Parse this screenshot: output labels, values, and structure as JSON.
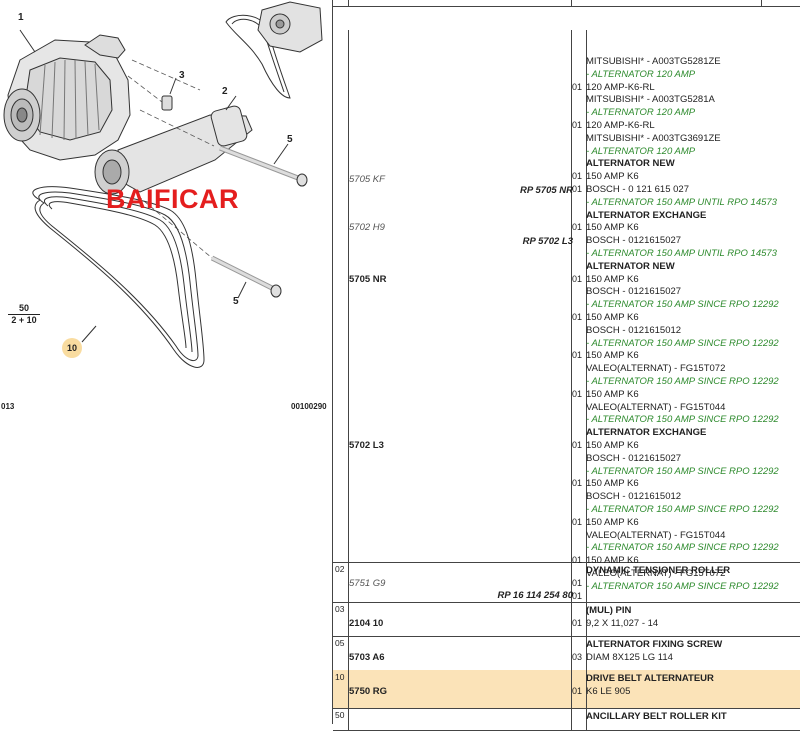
{
  "diagram": {
    "callouts": {
      "c1": "1",
      "c2": "2",
      "c3": "3",
      "c5a": "5",
      "c5b": "5"
    },
    "callout_10": "10",
    "fraction": {
      "num": "50",
      "den": "2 + 10"
    },
    "watermark": "BAIFICAR",
    "ref_left": "013",
    "ref_right": "00100290"
  },
  "table": {
    "header_fragment": "",
    "rows": [
      {
        "line": "",
        "refs": [
          {
            "text": "5705 KF",
            "style": "it",
            "top": 0
          },
          {
            "text": "5702 H9",
            "style": "it",
            "top": 0
          },
          {
            "text": "5705 NR",
            "style": "bold",
            "top": 0
          },
          {
            "text": "5702 L3",
            "style": "bold",
            "top": 0
          }
        ],
        "rps": [
          "RP 5705 NR",
          "RP 5702 L3"
        ],
        "entries": [
          {
            "q": "",
            "t": "MITSUBISHI* - A003TG5281ZE",
            "s": ""
          },
          {
            "q": "",
            "t": "- ALTERNATOR 120 AMP",
            "s": "g"
          },
          {
            "q": "01",
            "t": "120 AMP-K6-RL",
            "s": ""
          },
          {
            "q": "",
            "t": "MITSUBISHI* - A003TG5281A",
            "s": ""
          },
          {
            "q": "",
            "t": "- ALTERNATOR 120 AMP",
            "s": "g"
          },
          {
            "q": "01",
            "t": "120 AMP-K6-RL",
            "s": ""
          },
          {
            "q": "",
            "t": "MITSUBISHI* - A003TG3691ZE",
            "s": ""
          },
          {
            "q": "",
            "t": "- ALTERNATOR 120 AMP",
            "s": "g"
          },
          {
            "q": "",
            "t": "ALTERNATOR NEW",
            "s": "b"
          },
          {
            "q": "01",
            "t": "150 AMP K6",
            "s": ""
          },
          {
            "q": "01",
            "t": "BOSCH - 0 121 615 027",
            "s": ""
          },
          {
            "q": "",
            "t": "- ALTERNATOR 150 AMP UNTIL RPO 14573",
            "s": "g"
          },
          {
            "q": "",
            "t": "ALTERNATOR EXCHANGE",
            "s": "b"
          },
          {
            "q": "01",
            "t": "150 AMP K6",
            "s": ""
          },
          {
            "q": "",
            "t": "BOSCH - 0121615027",
            "s": ""
          },
          {
            "q": "",
            "t": "- ALTERNATOR 150 AMP UNTIL RPO 14573",
            "s": "g"
          },
          {
            "q": "",
            "t": "ALTERNATOR NEW",
            "s": "b"
          },
          {
            "q": "01",
            "t": "150 AMP K6",
            "s": ""
          },
          {
            "q": "",
            "t": "BOSCH - 0121615027",
            "s": ""
          },
          {
            "q": "",
            "t": "- ALTERNATOR 150 AMP SINCE RPO 12292",
            "s": "g"
          },
          {
            "q": "01",
            "t": "150 AMP K6",
            "s": ""
          },
          {
            "q": "",
            "t": "BOSCH - 0121615012",
            "s": ""
          },
          {
            "q": "",
            "t": "- ALTERNATOR 150 AMP SINCE RPO 12292",
            "s": "g"
          },
          {
            "q": "01",
            "t": "150 AMP K6",
            "s": ""
          },
          {
            "q": "",
            "t": "VALEO(ALTERNAT) - FG15T072",
            "s": ""
          },
          {
            "q": "",
            "t": "- ALTERNATOR 150 AMP SINCE RPO 12292",
            "s": "g"
          },
          {
            "q": "01",
            "t": "150 AMP K6",
            "s": ""
          },
          {
            "q": "",
            "t": "VALEO(ALTERNAT) - FG15T044",
            "s": ""
          },
          {
            "q": "",
            "t": "- ALTERNATOR 150 AMP SINCE RPO 12292",
            "s": "g"
          },
          {
            "q": "",
            "t": "ALTERNATOR EXCHANGE",
            "s": "b"
          },
          {
            "q": "01",
            "t": "150 AMP K6",
            "s": ""
          },
          {
            "q": "",
            "t": "BOSCH - 0121615027",
            "s": ""
          },
          {
            "q": "",
            "t": "- ALTERNATOR 150 AMP SINCE RPO 12292",
            "s": "g"
          },
          {
            "q": "01",
            "t": "150 AMP K6",
            "s": ""
          },
          {
            "q": "",
            "t": "BOSCH - 0121615012",
            "s": ""
          },
          {
            "q": "",
            "t": "- ALTERNATOR 150 AMP SINCE RPO 12292",
            "s": "g"
          },
          {
            "q": "01",
            "t": "150 AMP K6",
            "s": ""
          },
          {
            "q": "",
            "t": "VALEO(ALTERNAT) - FG15T044",
            "s": ""
          },
          {
            "q": "",
            "t": "- ALTERNATOR 150 AMP SINCE RPO 12292",
            "s": "g"
          },
          {
            "q": "01",
            "t": "150 AMP K6",
            "s": ""
          },
          {
            "q": "",
            "t": "VALEO(ALTERNAT) - FG15T072",
            "s": ""
          },
          {
            "q": "",
            "t": "- ALTERNATOR 150 AMP SINCE RPO 12292",
            "s": "g"
          }
        ]
      },
      {
        "line": "02",
        "refs": [
          {
            "text": "5751 G9",
            "style": "it"
          }
        ],
        "rps": [
          "RP 16 114 254 80"
        ],
        "entries": [
          {
            "q": "",
            "t": "DYNAMIC TENSIONER ROLLER",
            "s": "b"
          },
          {
            "q": "01",
            "t": "",
            "s": ""
          },
          {
            "q": "01",
            "t": "",
            "s": ""
          }
        ]
      },
      {
        "line": "03",
        "refs": [
          {
            "text": "2104 10",
            "style": "bold"
          }
        ],
        "rps": [],
        "entries": [
          {
            "q": "",
            "t": "(MUL) PIN",
            "s": "b"
          },
          {
            "q": "01",
            "t": "9,2 X 11,027 - 14",
            "s": ""
          }
        ]
      },
      {
        "line": "05",
        "refs": [
          {
            "text": "5703 A6",
            "style": "bold"
          }
        ],
        "rps": [],
        "entries": [
          {
            "q": "",
            "t": "ALTERNATOR FIXING SCREW",
            "s": "b"
          },
          {
            "q": "03",
            "t": "DIAM 8X125 LG 114",
            "s": ""
          }
        ]
      },
      {
        "line": "10",
        "refs": [
          {
            "text": "5750 RG",
            "style": "bold"
          }
        ],
        "rps": [],
        "entries": [
          {
            "q": "",
            "t": "DRIVE BELT ALTERNATEUR",
            "s": "b"
          },
          {
            "q": "01",
            "t": "K6 LE 905",
            "s": ""
          }
        ]
      },
      {
        "line": "50",
        "refs": [],
        "rps": [],
        "entries": [
          {
            "q": "",
            "t": "ANCILLARY BELT ROLLER KIT",
            "s": "b"
          }
        ]
      }
    ]
  }
}
